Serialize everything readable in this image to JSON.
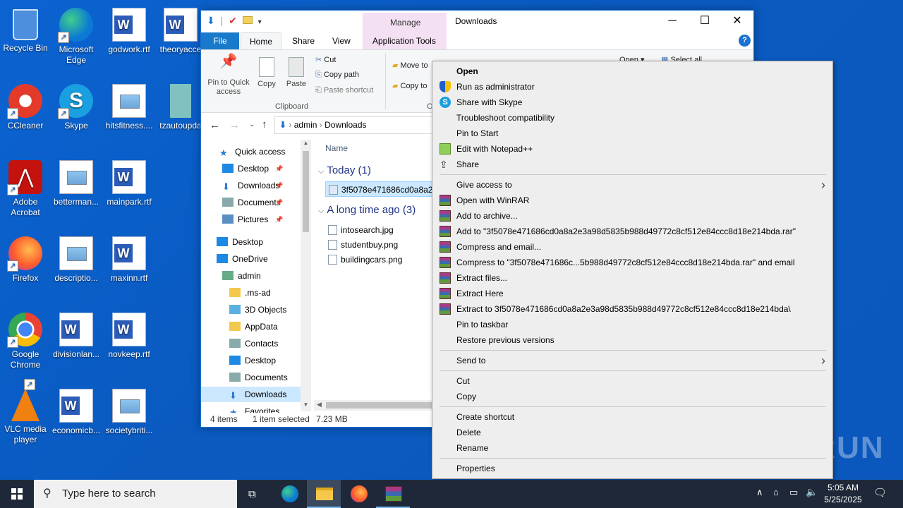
{
  "desktop": {
    "icons": [
      {
        "label": "Recycle Bin",
        "icon": "recycle-bin-icon"
      },
      {
        "label": "Microsoft Edge",
        "icon": "edge-icon"
      },
      {
        "label": "godwork.rtf",
        "icon": "word-doc-icon"
      },
      {
        "label": "theoryacce",
        "icon": "word-doc-icon"
      },
      {
        "label": "CCleaner",
        "icon": "ccleaner-icon"
      },
      {
        "label": "Skype",
        "icon": "skype-icon"
      },
      {
        "label": "hitsfitness....",
        "icon": "image-file-icon"
      },
      {
        "label": "tzautoupda",
        "icon": "file-icon"
      },
      {
        "label": "Adobe Acrobat",
        "icon": "acrobat-icon"
      },
      {
        "label": "betterman...",
        "icon": "image-file-icon"
      },
      {
        "label": "mainpark.rtf",
        "icon": "word-doc-icon"
      },
      {
        "label": "Firefox",
        "icon": "firefox-icon"
      },
      {
        "label": "descriptio...",
        "icon": "image-file-icon"
      },
      {
        "label": "maxinn.rtf",
        "icon": "word-doc-icon"
      },
      {
        "label": "Google Chrome",
        "icon": "chrome-icon"
      },
      {
        "label": "divisionlan...",
        "icon": "word-doc-icon"
      },
      {
        "label": "novkeep.rtf",
        "icon": "word-doc-icon"
      },
      {
        "label": "VLC media player",
        "icon": "vlc-icon"
      },
      {
        "label": "economicb...",
        "icon": "word-doc-icon"
      },
      {
        "label": "societybriti...",
        "icon": "image-file-icon"
      }
    ]
  },
  "explorer": {
    "title": "Downloads",
    "manage_label": "Manage",
    "tabs": [
      "File",
      "Home",
      "Share",
      "View",
      "Application Tools"
    ],
    "ribbon": {
      "pin_label": "Pin to Quick access",
      "copy_label": "Copy",
      "paste_label": "Paste",
      "cut_label": "Cut",
      "copy_path_label": "Copy path",
      "paste_shortcut_label": "Paste shortcut",
      "clipboard_group": "Clipboard",
      "move_to_label": "Move to",
      "copy_to_label": "Copy to",
      "org_group_partial": "O",
      "open_label": "Open",
      "select_all_label": "Select all"
    },
    "address": {
      "crumbs": [
        "admin",
        "Downloads"
      ]
    },
    "nav": [
      {
        "label": "Quick access",
        "icon": "star-icon",
        "pinned": false
      },
      {
        "label": "Desktop",
        "icon": "desktop-icon",
        "pinned": true
      },
      {
        "label": "Downloads",
        "icon": "download-icon",
        "pinned": true
      },
      {
        "label": "Documents",
        "icon": "documents-icon",
        "pinned": true
      },
      {
        "label": "Pictures",
        "icon": "pictures-icon",
        "pinned": true
      },
      {
        "label": "Desktop",
        "icon": "desktop-icon",
        "pinned": false
      },
      {
        "label": "OneDrive",
        "icon": "cloud-icon",
        "pinned": false
      },
      {
        "label": "admin",
        "icon": "user-icon",
        "pinned": false
      },
      {
        "label": ".ms-ad",
        "icon": "folder-icon",
        "pinned": false
      },
      {
        "label": "3D Objects",
        "icon": "cube-icon",
        "pinned": false
      },
      {
        "label": "AppData",
        "icon": "folder-icon",
        "pinned": false
      },
      {
        "label": "Contacts",
        "icon": "contacts-icon",
        "pinned": false
      },
      {
        "label": "Desktop",
        "icon": "desktop-icon",
        "pinned": false
      },
      {
        "label": "Documents",
        "icon": "documents-icon",
        "pinned": false
      },
      {
        "label": "Downloads",
        "icon": "download-icon",
        "pinned": false
      },
      {
        "label": "Favorites",
        "icon": "star-icon",
        "pinned": false
      }
    ],
    "column_name": "Name",
    "groups": [
      {
        "title": "Today (1)",
        "files": [
          "3f5078e471686cd0a8a2e3"
        ]
      },
      {
        "title": "A long time ago (3)",
        "files": [
          "intosearch.jpg",
          "studentbuy.png",
          "buildingcars.png"
        ]
      }
    ],
    "status": {
      "count": "4 items",
      "selected": "1 item selected",
      "size": "7.23 MB"
    }
  },
  "context_menu": {
    "items": [
      {
        "label": "Open",
        "bold": true,
        "icon": ""
      },
      {
        "label": "Run as administrator",
        "icon": "uac-shield-icon"
      },
      {
        "label": "Share with Skype",
        "icon": "skype-icon"
      },
      {
        "label": "Troubleshoot compatibility",
        "icon": ""
      },
      {
        "label": "Pin to Start",
        "icon": ""
      },
      {
        "label": "Edit with Notepad++",
        "icon": "notepadpp-icon"
      },
      {
        "label": "Share",
        "icon": "share-icon"
      },
      {
        "sep": true
      },
      {
        "label": "Give access to",
        "icon": "",
        "submenu": true
      },
      {
        "label": "Open with WinRAR",
        "icon": "winrar-icon"
      },
      {
        "label": "Add to archive...",
        "icon": "winrar-icon"
      },
      {
        "label": "Add to \"3f5078e471686cd0a8a2e3a98d5835b988d49772c8cf512e84ccc8d18e214bda.rar\"",
        "icon": "winrar-icon"
      },
      {
        "label": "Compress and email...",
        "icon": "winrar-icon"
      },
      {
        "label": "Compress to \"3f5078e471686c...5b988d49772c8cf512e84ccc8d18e214bda.rar\" and email",
        "icon": "winrar-icon"
      },
      {
        "label": "Extract files...",
        "icon": "winrar-icon"
      },
      {
        "label": "Extract Here",
        "icon": "winrar-icon"
      },
      {
        "label": "Extract to 3f5078e471686cd0a8a2e3a98d5835b988d49772c8cf512e84ccc8d18e214bda\\",
        "icon": "winrar-icon"
      },
      {
        "label": "Pin to taskbar",
        "icon": ""
      },
      {
        "label": "Restore previous versions",
        "icon": ""
      },
      {
        "sep": true
      },
      {
        "label": "Send to",
        "icon": "",
        "submenu": true
      },
      {
        "sep": true
      },
      {
        "label": "Cut",
        "icon": ""
      },
      {
        "label": "Copy",
        "icon": ""
      },
      {
        "sep": true
      },
      {
        "label": "Create shortcut",
        "icon": ""
      },
      {
        "label": "Delete",
        "icon": ""
      },
      {
        "label": "Rename",
        "icon": ""
      },
      {
        "sep": true
      },
      {
        "label": "Properties",
        "icon": ""
      }
    ]
  },
  "taskbar": {
    "search_placeholder": "Type here to search",
    "time": "5:05 AM",
    "date": "5/25/2025"
  },
  "watermark": "ANY RUN",
  "colors": {
    "accent": "#0078d7",
    "desktop": "#0b63d1",
    "taskbar": "#1f2838",
    "menu_bg": "#eeeeee"
  }
}
